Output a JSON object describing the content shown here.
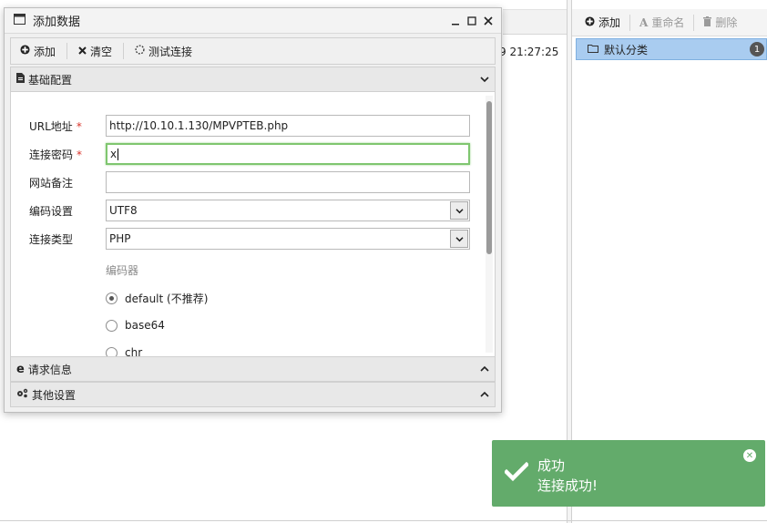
{
  "background": {
    "timestamp_fragment": "9 21:27:25"
  },
  "right_panel": {
    "toolbar": {
      "add_label": "添加",
      "rename_label": "重命名",
      "delete_label": "删除"
    },
    "categories": [
      {
        "label": "默认分类",
        "count": "1"
      }
    ]
  },
  "dialog": {
    "title": "添加数据",
    "toolbar": {
      "add_label": "添加",
      "clear_label": "清空",
      "test_label": "测试连接"
    },
    "sections": {
      "basic": "基础配置",
      "request": "请求信息",
      "other": "其他设置"
    },
    "form": {
      "url_label": "URL地址",
      "url_value": "http://10.10.1.130/MPVPTEB.php",
      "password_label": "连接密码",
      "password_value": "x",
      "note_label": "网站备注",
      "note_value": "",
      "encoding_label": "编码设置",
      "encoding_value": "UTF8",
      "type_label": "连接类型",
      "type_value": "PHP",
      "required_mark": "*"
    },
    "encoder": {
      "label": "编码器",
      "options": [
        {
          "label": "default (不推荐)",
          "checked": true
        },
        {
          "label": "base64",
          "checked": false
        },
        {
          "label": "chr",
          "checked": false
        }
      ]
    }
  },
  "toast": {
    "title": "成功",
    "message": "连接成功!",
    "color": "#63ab6b"
  }
}
